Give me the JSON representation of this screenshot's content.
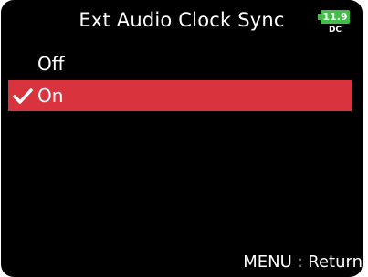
{
  "header": {
    "title": "Ext Audio Clock Sync",
    "battery": {
      "level": "11.9",
      "source": "DC",
      "color": "#3fbf47"
    }
  },
  "options": [
    {
      "label": "Off",
      "selected": false
    },
    {
      "label": "On",
      "selected": true
    }
  ],
  "selection_color": "#d9343d",
  "footer": {
    "hint": "MENU : Return"
  }
}
